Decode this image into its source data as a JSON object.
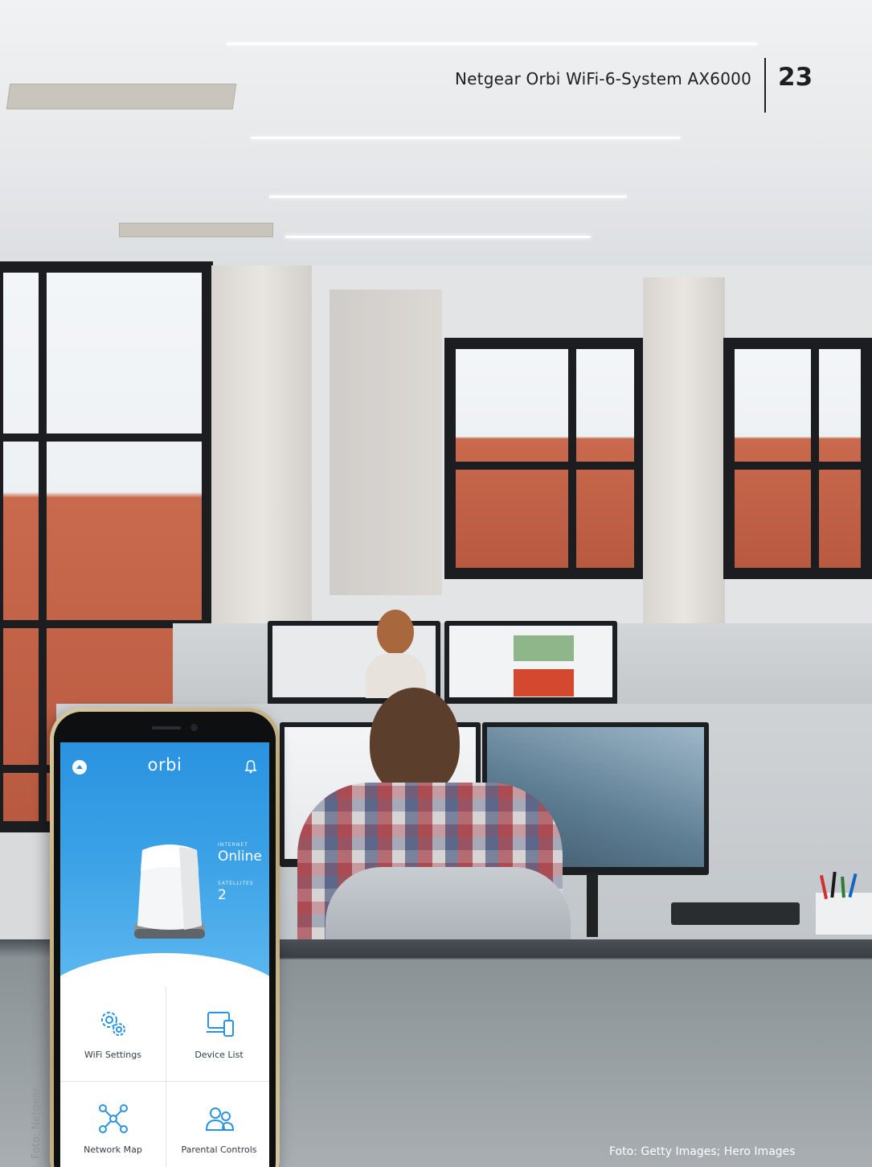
{
  "header": {
    "title": "Netgear Orbi WiFi-6-System AX6000",
    "page_number": "23"
  },
  "credits": {
    "left": "Foto: Netgear",
    "right": "Foto: Getty Images; Hero Images"
  },
  "phone_app": {
    "logo": "orbi",
    "status": {
      "internet_label": "INTERNET",
      "internet_value": "Online",
      "satellites_label": "SATELLITES",
      "satellites_value": "2"
    },
    "tiles": [
      {
        "label": "WiFi Settings",
        "icon": "gears-icon"
      },
      {
        "label": "Device List",
        "icon": "devices-icon"
      },
      {
        "label": "Network Map",
        "icon": "network-map-icon"
      },
      {
        "label": "Parental Controls",
        "icon": "users-icon"
      }
    ],
    "colors": {
      "accent": "#2a93e0",
      "icon": "#2a93e0"
    }
  }
}
